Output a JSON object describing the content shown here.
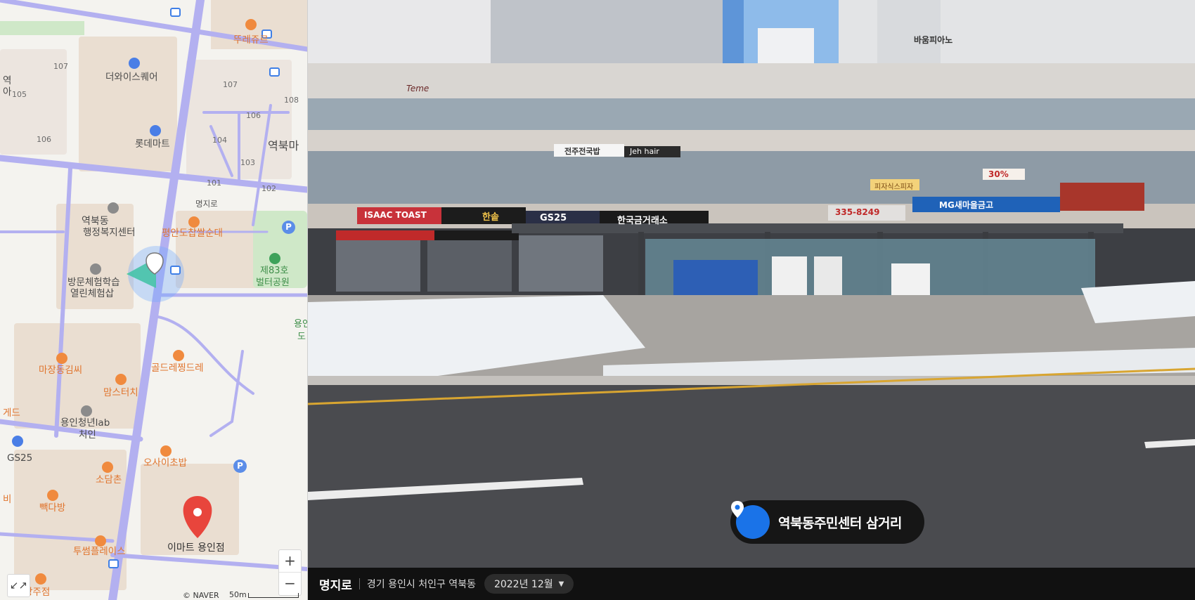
{
  "map": {
    "pois": {
      "ttureju": "뚜레쥬르",
      "the_wise_square": "더와이스퀘어",
      "lotte_mart": "롯데마트",
      "yeokbuk_station": "역북마",
      "yeok": "역",
      "community_center_1": "역북동",
      "community_center_2": "행정복지센터",
      "pyeongan": "평안도찹쌀순대",
      "park_1": "제83호",
      "park_2": "벌터공원",
      "visit_1": "방문체험학습",
      "visit_2": "열린체험삽",
      "majang": "마장동김씨",
      "mamsteochi": "맘스터치",
      "golden": "골드레찡드레",
      "youth_lab_1": "용인청년lab",
      "youth_lab_2": "처인",
      "gs25": "GS25",
      "osai": "오사이초밥",
      "sodamchon": "소담촌",
      "baekdabang": "빽다방",
      "emart": "이마트 용인점",
      "tusseom": "투썸플레이스",
      "changjujeom": "창주점",
      "gedeu": "게드",
      "bi": "비",
      "yong": "용인",
      "do": "도",
      "oh": "아"
    },
    "building_numbers": [
      "107",
      "105",
      "106",
      "107",
      "108",
      "106",
      "104",
      "103",
      "101",
      "102"
    ],
    "road_label": "명지로",
    "zoom_in": "+",
    "zoom_out": "−",
    "collapse_icon": "↙↗",
    "credit": "© NAVER",
    "scale": "50m",
    "colors": {
      "road": "#b3b0f0",
      "land": "#f4f3ef",
      "block": "#eaded1",
      "park": "#cfe8c8",
      "view_cone": "#2fd27a",
      "marker": "#e8453c"
    }
  },
  "street": {
    "place_name": "역북동주민센터 삼거리",
    "road_name": "명지로",
    "address": "경기 용인시 처인구 역북동",
    "capture_date": "2022년 12월",
    "date_caret": "▼",
    "shop_signs": {
      "isaac": "ISAAC TOAST",
      "hansol": "한솥",
      "gs25": "GS25",
      "korea_gold": "한국금거래소",
      "mg": "MG새마을금고",
      "jeonju": "전주전국밥",
      "jeh_hair": "Jeh hair",
      "phone": "335-8249",
      "barun": "바움피아노",
      "teme": "Teme",
      "pizza": "피자식스피자",
      "thirty": "30%"
    }
  }
}
